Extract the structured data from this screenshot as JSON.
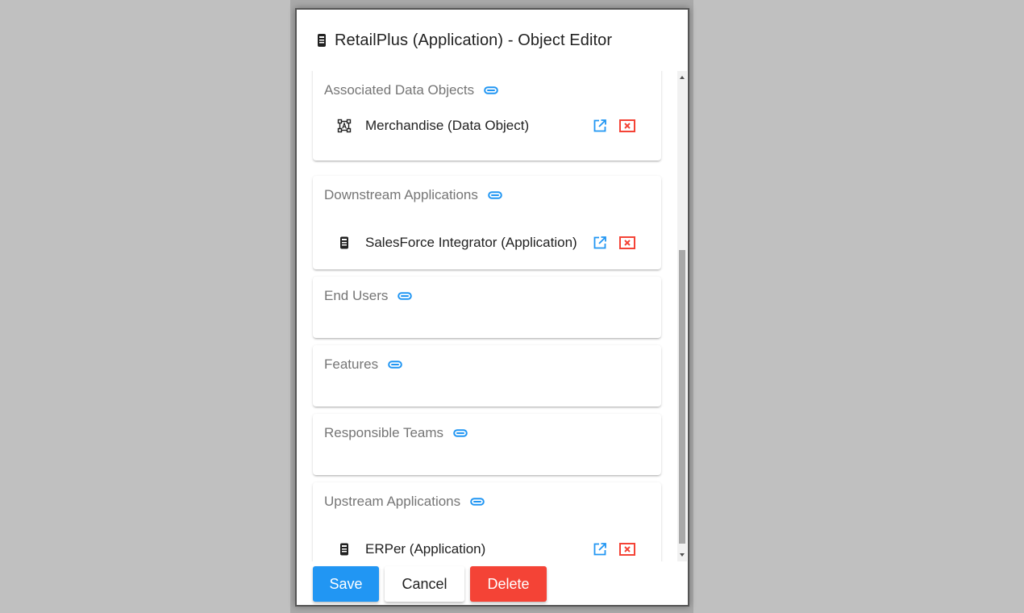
{
  "dialog": {
    "title": "RetailPlus (Application) - Object Editor",
    "title_icon": "mobile-app-icon"
  },
  "sections": [
    {
      "title": "Associated Data Objects",
      "items": [
        {
          "label": "Merchandise (Data Object)",
          "icon": "data-object-icon"
        }
      ]
    },
    {
      "title": "Downstream Applications",
      "items": [
        {
          "label": "SalesForce Integrator (Application)",
          "icon": "mobile-app-icon"
        }
      ]
    },
    {
      "title": "End Users",
      "items": []
    },
    {
      "title": "Features",
      "items": []
    },
    {
      "title": "Responsible Teams",
      "items": []
    },
    {
      "title": "Upstream Applications",
      "items": [
        {
          "label": "ERPer (Application)",
          "icon": "mobile-app-icon"
        }
      ]
    }
  ],
  "footer": {
    "save_label": "Save",
    "cancel_label": "Cancel",
    "delete_label": "Delete"
  },
  "colors": {
    "accent": "#2196f3",
    "danger": "#f44336",
    "open_icon": "#2196f3",
    "remove_icon": "#f44336"
  }
}
